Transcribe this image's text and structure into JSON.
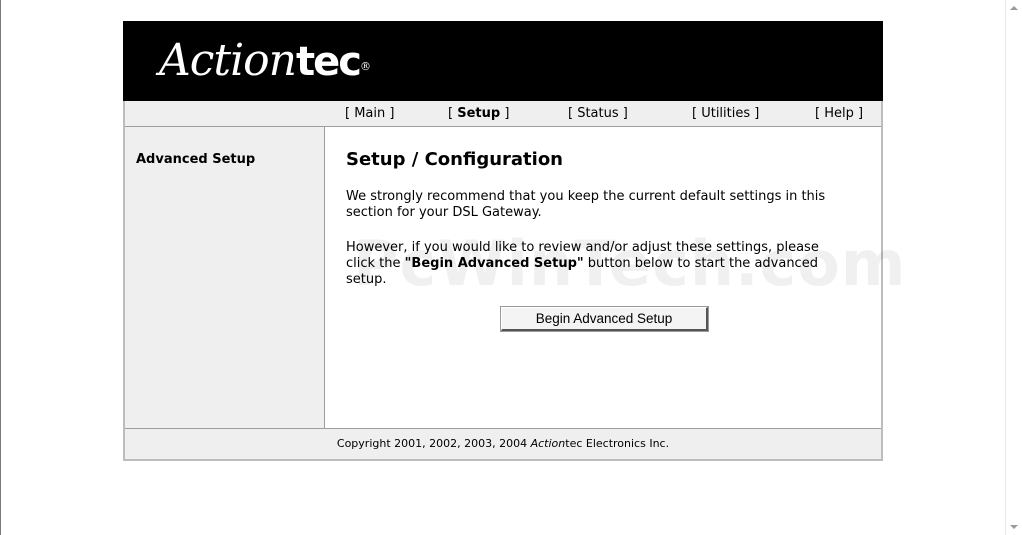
{
  "header": {
    "logo_text": "Action",
    "logo_tec": "tec",
    "logo_registered": "®"
  },
  "nav": {
    "main": "[ Main ]",
    "setup_open": "[ ",
    "setup": "Setup",
    "setup_close": " ]",
    "status": "[ Status ]",
    "utilities": "[ Utilities ]",
    "help": "[ Help ]"
  },
  "sidebar": {
    "title": "Advanced Setup"
  },
  "main": {
    "title": "Setup / Configuration",
    "paragraph1": "We strongly recommend that you keep the current default settings in this section for your DSL Gateway.",
    "paragraph2_before": "However, if you would like to review and/or adjust these settings, please click the ",
    "paragraph2_bold": "\"Begin Advanced Setup\"",
    "paragraph2_after": " button below to start the advanced setup.",
    "button_label": "Begin Advanced Setup",
    "watermark": "PcWinTech.com"
  },
  "footer": {
    "copyright_before": "Copyright 2001, 2002, 2003, 2004 ",
    "brand_italic": "Action",
    "brand_rest": "tec Electronics Inc."
  },
  "colors": {
    "banner": "#000000",
    "panel": "#efefef",
    "border": "#9d9d9d"
  }
}
